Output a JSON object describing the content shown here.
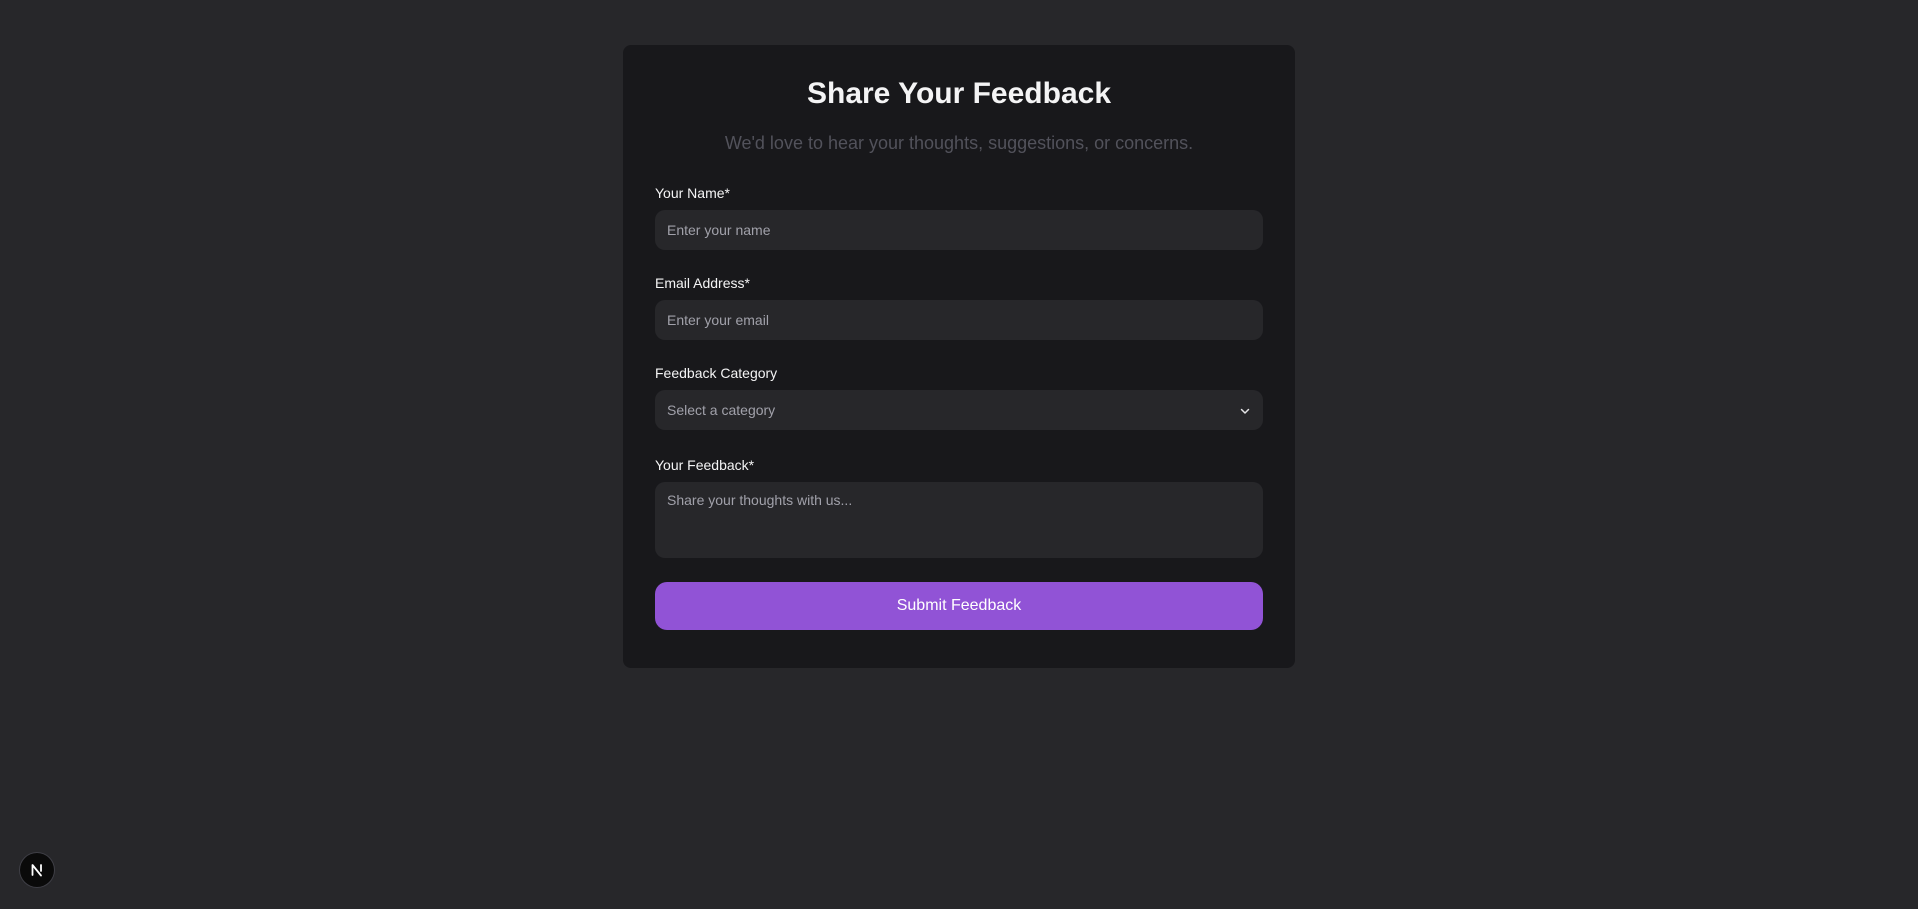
{
  "form": {
    "title": "Share Your Feedback",
    "subtitle": "We'd love to hear your thoughts, suggestions, or concerns.",
    "name_field": {
      "label": "Your Name*",
      "value": "",
      "placeholder": "Enter your name"
    },
    "email_field": {
      "label": "Email Address*",
      "value": "",
      "placeholder": "Enter your email"
    },
    "category_field": {
      "label": "Feedback Category",
      "selected": "Select a category"
    },
    "feedback_field": {
      "label": "Your Feedback*",
      "value": "",
      "placeholder": "Share your thoughts with us..."
    },
    "submit_label": "Submit Feedback"
  },
  "icons": {
    "category_dropdown": "chevron-down-icon",
    "dev_badge": "nextjs-logo-icon"
  },
  "colors": {
    "page_background": "#27272a",
    "card_background": "#18181b",
    "input_background": "#27272a",
    "accent": "#9153d6",
    "text_primary": "#f4f4f5",
    "text_muted": "#52525b",
    "placeholder": "#a1a1aa"
  }
}
